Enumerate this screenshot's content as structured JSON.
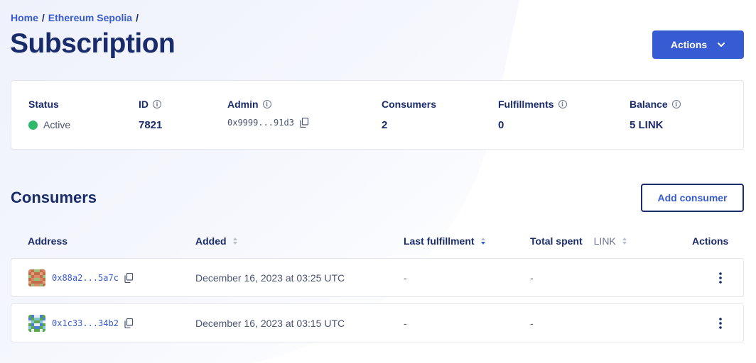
{
  "breadcrumb": {
    "home": "Home",
    "network": "Ethereum Sepolia",
    "separator": "/"
  },
  "page_title": "Subscription",
  "actions_button": {
    "label": "Actions"
  },
  "info": {
    "status": {
      "label": "Status",
      "value": "Active",
      "color": "#2fb96c"
    },
    "id": {
      "label": "ID",
      "value": "7821"
    },
    "admin": {
      "label": "Admin",
      "value": "0x9999...91d3"
    },
    "consumers": {
      "label": "Consumers",
      "value": "2"
    },
    "fulfillments": {
      "label": "Fulfillments",
      "value": "0"
    },
    "balance": {
      "label": "Balance",
      "value": "5 LINK"
    }
  },
  "consumers_section": {
    "heading": "Consumers",
    "add_button": "Add consumer",
    "columns": {
      "address": "Address",
      "added": "Added",
      "last_fulfillment": "Last fulfillment",
      "total_spent": "Total spent",
      "total_spent_unit": "LINK",
      "actions": "Actions"
    },
    "rows": [
      {
        "address": "0x88a2...5a7c",
        "added": "December 16, 2023 at 03:25 UTC",
        "last_fulfillment": "-",
        "total_spent": "-"
      },
      {
        "address": "0x1c33...34b2",
        "added": "December 16, 2023 at 03:15 UTC",
        "last_fulfillment": "-",
        "total_spent": "-"
      }
    ]
  },
  "colors": {
    "accent": "#375bd2",
    "navy": "#1a2b6b",
    "border": "#e3e6ee"
  },
  "icons": [
    "chevron-down-icon",
    "info-icon",
    "copy-icon",
    "sort-icon",
    "sort-desc-icon",
    "kebab-menu-icon",
    "identicon-avatar"
  ]
}
